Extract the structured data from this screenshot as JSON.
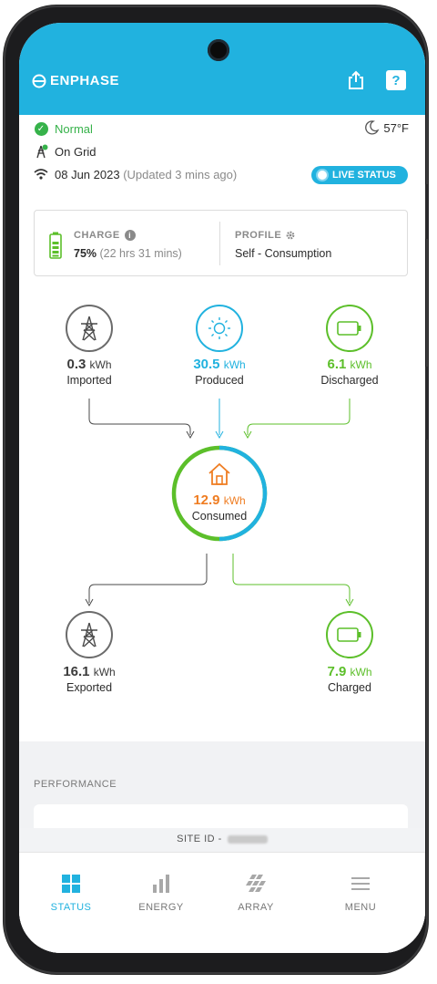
{
  "header": {
    "brand": "ENPHASE"
  },
  "status": {
    "state": "Normal",
    "grid": "On Grid",
    "date": "08 Jun 2023",
    "updated": "(Updated 3 mins ago)",
    "temperature": "57°F",
    "live_label": "LIVE STATUS"
  },
  "card": {
    "charge_label": "CHARGE",
    "charge_value": "75%",
    "charge_time": "(22 hrs 31 mins)",
    "profile_label": "PROFILE",
    "profile_value": "Self - Consumption"
  },
  "flow": {
    "unit": "kWh",
    "imported": {
      "value": "0.3",
      "label": "Imported"
    },
    "produced": {
      "value": "30.5",
      "label": "Produced"
    },
    "discharged": {
      "value": "6.1",
      "label": "Discharged"
    },
    "consumed": {
      "value": "12.9",
      "label": "Consumed"
    },
    "exported": {
      "value": "16.1",
      "label": "Exported"
    },
    "charged": {
      "value": "7.9",
      "label": "Charged"
    }
  },
  "performance": {
    "title": "PERFORMANCE",
    "site_id_label": "SITE ID -"
  },
  "nav": {
    "items": [
      {
        "label": "STATUS",
        "icon": "grid-icon",
        "active": true
      },
      {
        "label": "ENERGY",
        "icon": "bar-chart-icon",
        "active": false
      },
      {
        "label": "ARRAY",
        "icon": "array-icon",
        "active": false
      },
      {
        "label": "MENU",
        "icon": "menu-icon",
        "active": false
      }
    ]
  },
  "colors": {
    "accent": "#21b2df",
    "green": "#5cbf2a",
    "orange": "#ef7d22",
    "status_green": "#36b24a"
  }
}
